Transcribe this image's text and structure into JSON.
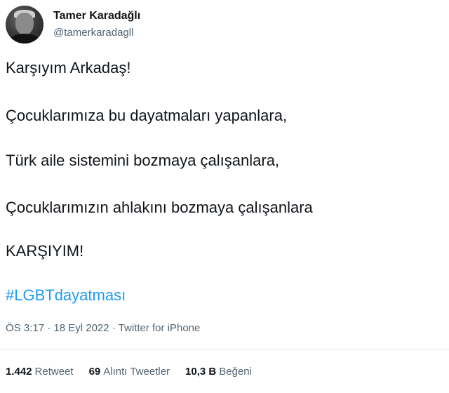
{
  "author": {
    "display_name": "Tamer Karadağlı",
    "handle": "@tamerkaradagll"
  },
  "tweet": {
    "lines": [
      "Karşıyım Arkadaş!",
      "Çocuklarımıza bu dayatmaları yapanlara,",
      "Türk aile sistemini bozmaya çalışanlara,",
      "Çocuklarımızın ahlakını bozmaya çalışanlara",
      "KARŞIYIM!"
    ],
    "hashtag": "#LGBTdayatması",
    "meta": "ÖS 3:17 · 18 Eyl 2022 · Twitter for iPhone"
  },
  "stats": {
    "retweets": {
      "count": "1.442",
      "label": "Retweet"
    },
    "quotes": {
      "count": "69",
      "label": "Alıntı Tweetler"
    },
    "likes": {
      "count": "10,3 B",
      "label": "Beğeni"
    }
  },
  "colors": {
    "link": "#1d9bf0",
    "secondary_text": "#536471",
    "primary_text": "#0f1419"
  }
}
